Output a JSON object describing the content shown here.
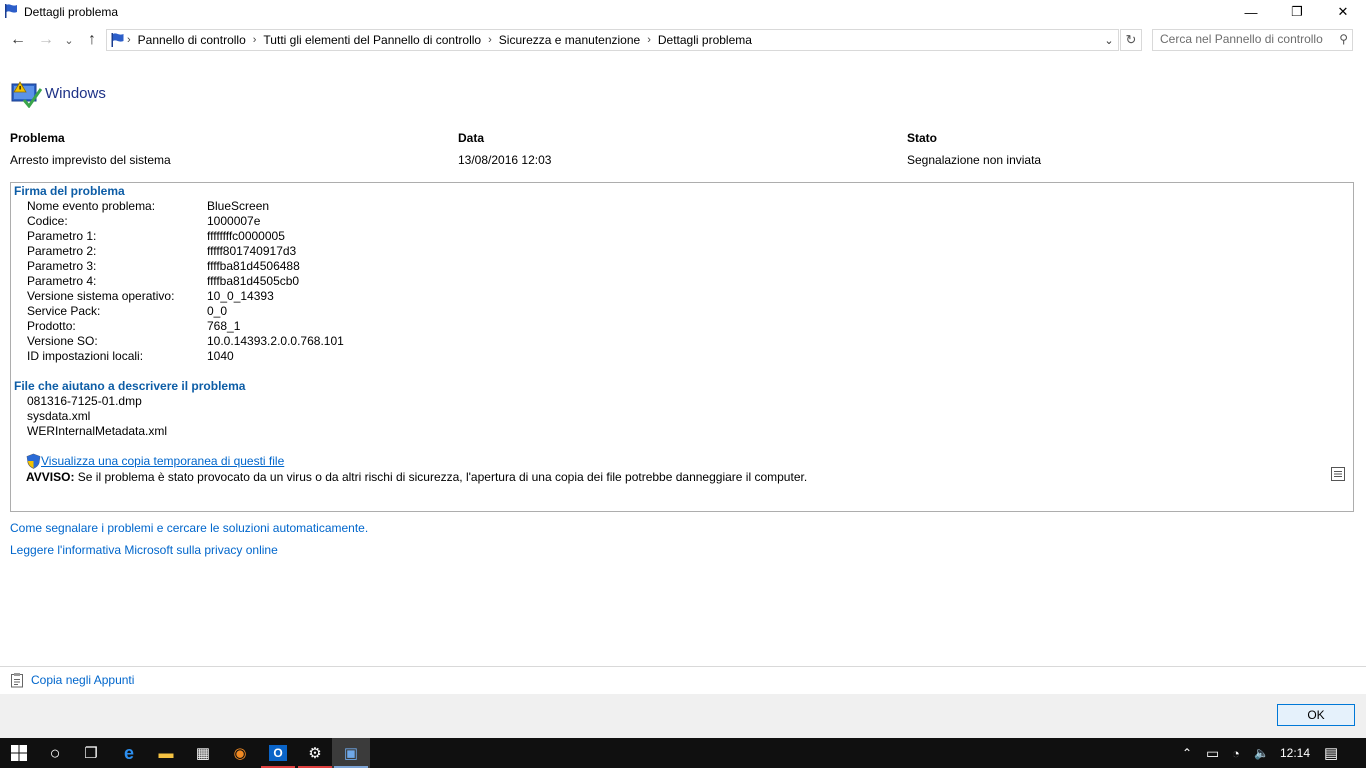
{
  "window": {
    "title": "Dettagli problema",
    "minimize_glyph": "—",
    "restore_glyph": "❐",
    "close_glyph": "✕"
  },
  "nav": {
    "back_glyph": "←",
    "forward_glyph": "→",
    "recent_glyph": "⌄",
    "up_glyph": "↑",
    "breadcrumbs": [
      "Pannello di controllo",
      "Tutti gli elementi del Pannello di controllo",
      "Sicurezza e manutenzione",
      "Dettagli problema"
    ],
    "sep": "›",
    "dropdown_glyph": "⌄",
    "refresh_glyph": "↻",
    "search_placeholder": "Cerca nel Pannello di controllo",
    "search_glyph": "⚲"
  },
  "header": {
    "source": "Windows"
  },
  "columns": {
    "problem_label": "Problema",
    "problem_value": "Arresto imprevisto del sistema",
    "date_label": "Data",
    "date_value": "13/08/2016 12:03",
    "status_label": "Stato",
    "status_value": "Segnalazione non inviata"
  },
  "signature": {
    "heading": "Firma del problema",
    "rows": [
      {
        "k": "Nome evento problema:",
        "v": "BlueScreen"
      },
      {
        "k": "Codice:",
        "v": "1000007e"
      },
      {
        "k": "Parametro 1:",
        "v": "ffffffffc0000005"
      },
      {
        "k": "Parametro 2:",
        "v": "fffff801740917d3"
      },
      {
        "k": "Parametro 3:",
        "v": "ffffba81d4506488"
      },
      {
        "k": "Parametro 4:",
        "v": "ffffba81d4505cb0"
      },
      {
        "k": "Versione sistema operativo:",
        "v": "10_0_14393"
      },
      {
        "k": "Service Pack:",
        "v": "0_0"
      },
      {
        "k": "Prodotto:",
        "v": "768_1"
      },
      {
        "k": "Versione SO:",
        "v": "10.0.14393.2.0.0.768.101"
      },
      {
        "k": "ID impostazioni locali:",
        "v": "1040"
      }
    ]
  },
  "files": {
    "heading": "File che aiutano a descrivere il problema",
    "items": [
      "081316-7125-01.dmp",
      "sysdata.xml",
      "WERInternalMetadata.xml"
    ],
    "view_link": "Visualizza una copia temporanea di questi file",
    "warning_label": "AVVISO:",
    "warning_text": " Se il problema è stato provocato da un virus o da altri rischi di sicurezza, l'apertura di una copia dei file potrebbe danneggiare il computer."
  },
  "links": {
    "how_to_report": "Come segnalare i problemi e cercare le soluzioni automaticamente.",
    "privacy": "Leggere l'informativa Microsoft sulla privacy online"
  },
  "footer": {
    "copy_label": "Copia negli Appunti",
    "ok_label": "OK"
  },
  "taskbar": {
    "time": "12:14",
    "ime_glyph": "⌃",
    "battery_glyph": "▭",
    "wifi_glyph": "◔",
    "volume_glyph": "🔈",
    "notification_glyph": "▤",
    "start_glyph": "⊞",
    "search_glyph": "○",
    "taskview_glyph": "❐",
    "edge_glyph": "e",
    "explorer_glyph": "▬",
    "store_glyph": "▦",
    "firefox_glyph": "◉",
    "outlook_glyph": "O",
    "settings_glyph": "⚙",
    "controlpanel_glyph": "▣"
  },
  "colors": {
    "link": "#0066cc",
    "heading_blue": "#0d5da6",
    "taskbar": "#101010",
    "ok_border": "#0078d7"
  }
}
